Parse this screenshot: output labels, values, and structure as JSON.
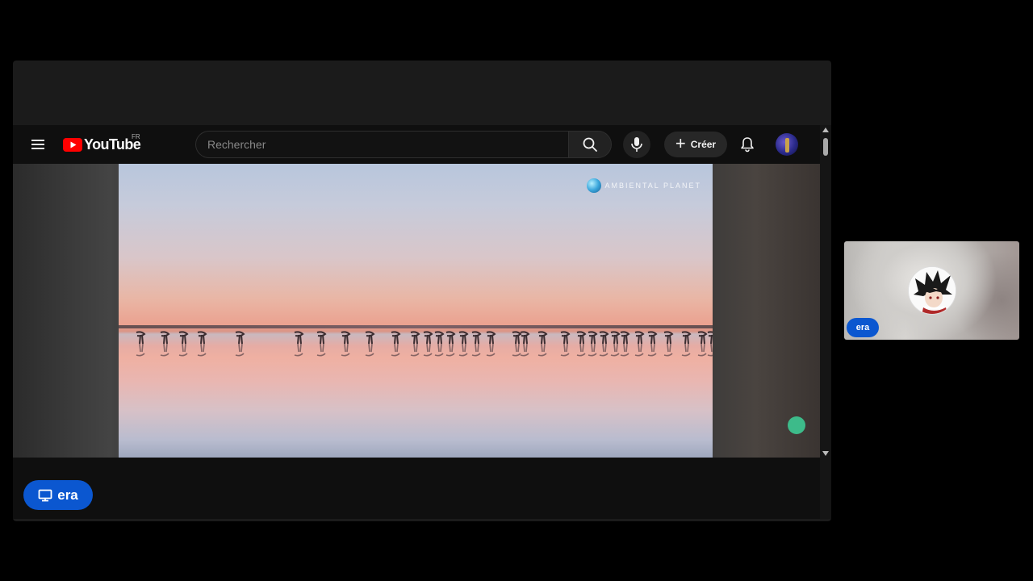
{
  "presentation": {
    "presenter_name": "era",
    "presenter_icon": "present-screen-icon"
  },
  "youtube": {
    "logo_text": "YouTube",
    "region_code": "FR",
    "search_placeholder": "Rechercher",
    "create_label": "Créer",
    "icons": {
      "menu": "hamburger-menu-icon",
      "search": "search-icon",
      "mic": "microphone-icon",
      "create": "plus-icon",
      "notifications": "bell-icon"
    }
  },
  "video": {
    "watermark_text": "AMBIENTAL PLANET"
  },
  "participant": {
    "name": "era"
  },
  "colors": {
    "accent": "#0b57d0",
    "youtube_red": "#ff0000",
    "youtube_bg": "#0f0f0f"
  }
}
